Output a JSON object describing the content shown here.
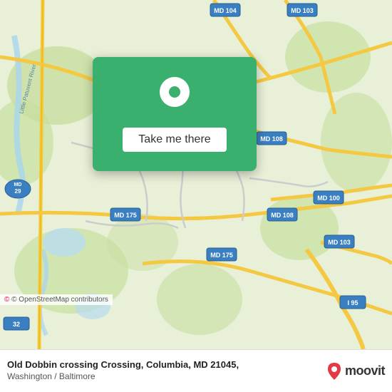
{
  "map": {
    "background_color": "#e8f0d8",
    "center_lat": 39.21,
    "center_lon": -76.87
  },
  "button": {
    "label": "Take me there",
    "background": "#3ab06e"
  },
  "attribution": {
    "text": "© OpenStreetMap contributors"
  },
  "location": {
    "name": "Old Dobbin crossing Crossing, Columbia, MD 21045,",
    "region": "Washington / Baltimore"
  },
  "moovit": {
    "text": "moovit"
  },
  "icons": {
    "pin": "location-pin-icon",
    "moovit_pin": "moovit-pin-icon"
  }
}
